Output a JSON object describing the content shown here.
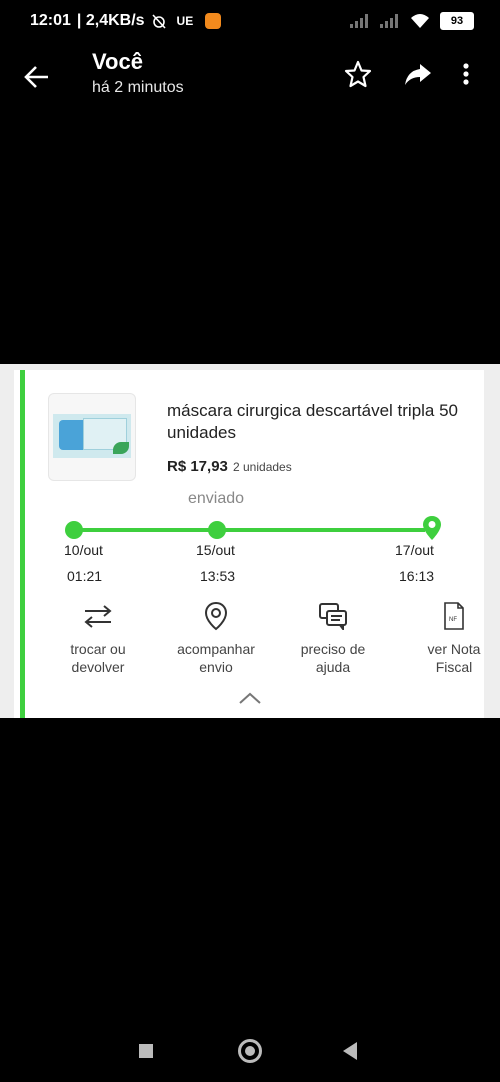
{
  "status_bar": {
    "time": "12:01",
    "speed": "| 2,4KB/s",
    "carrier": "UE",
    "battery": "93"
  },
  "header": {
    "title": "Você",
    "subtitle": "há 2 minutos"
  },
  "product": {
    "title": "máscara cirurgica descartável tripla 50 unidades",
    "price": "R$ 17,93",
    "quantity": "2 unidades",
    "status": "enviado"
  },
  "timeline": [
    {
      "date": "10/out",
      "time": "01:21"
    },
    {
      "date": "15/out",
      "time": "13:53"
    },
    {
      "date": "17/out",
      "time": "16:13"
    }
  ],
  "actions": [
    {
      "label": "trocar ou devolver",
      "icon": "swap-arrows-icon"
    },
    {
      "label": "acompanhar envio",
      "icon": "location-pin-icon"
    },
    {
      "label": "preciso de ajuda",
      "icon": "chat-bubbles-icon"
    },
    {
      "label": "ver Nota Fiscal",
      "icon": "invoice-document-icon"
    }
  ],
  "colors": {
    "accent": "#3ecf3e",
    "background": "#000000",
    "card": "#ffffff"
  }
}
